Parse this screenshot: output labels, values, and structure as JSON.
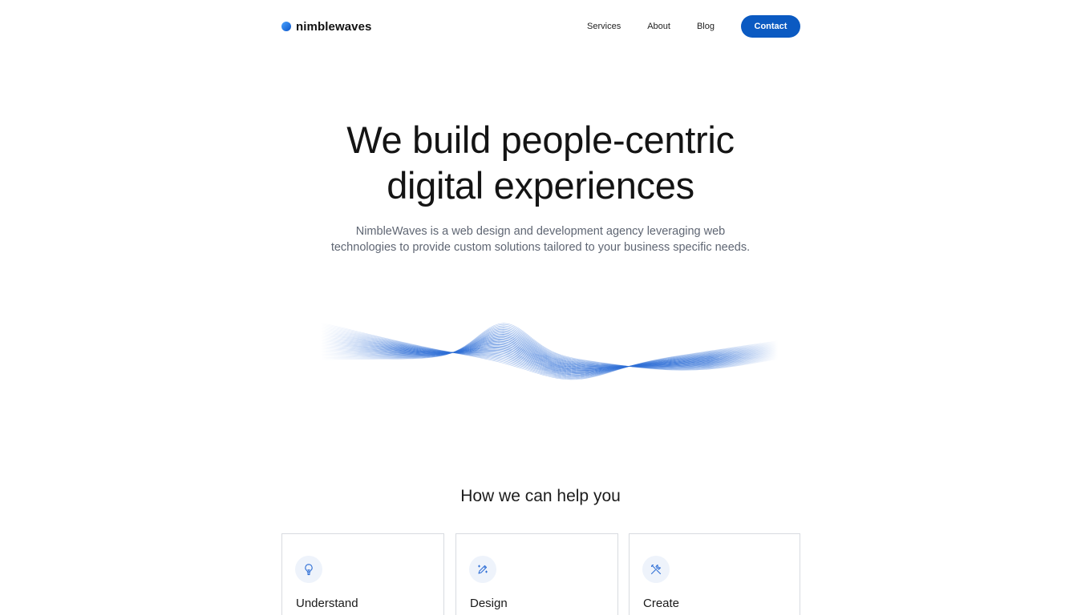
{
  "brand": {
    "name": "nimblewaves",
    "mark_gradient": [
      "#4aa3ff",
      "#0b55c9"
    ]
  },
  "nav": {
    "items": [
      {
        "label": "Services"
      },
      {
        "label": "About"
      },
      {
        "label": "Blog"
      }
    ],
    "contact_label": "Contact",
    "contact_color": "#0b5ac2"
  },
  "hero": {
    "title_line1": "We build people-centric",
    "title_line2": "digital experiences",
    "subtitle_line1": "NimbleWaves is a web design and development agency leveraging web",
    "subtitle_line2": "technologies to provide custom solutions tailored to your business specific needs.",
    "wave_color": "#2f6fd6"
  },
  "services": {
    "title": "How we can help you",
    "cards": [
      {
        "title": "Understand",
        "icon": "lightbulb-icon"
      },
      {
        "title": "Design",
        "icon": "pen-sparkle-icon"
      },
      {
        "title": "Create",
        "icon": "tools-icon"
      }
    ]
  }
}
